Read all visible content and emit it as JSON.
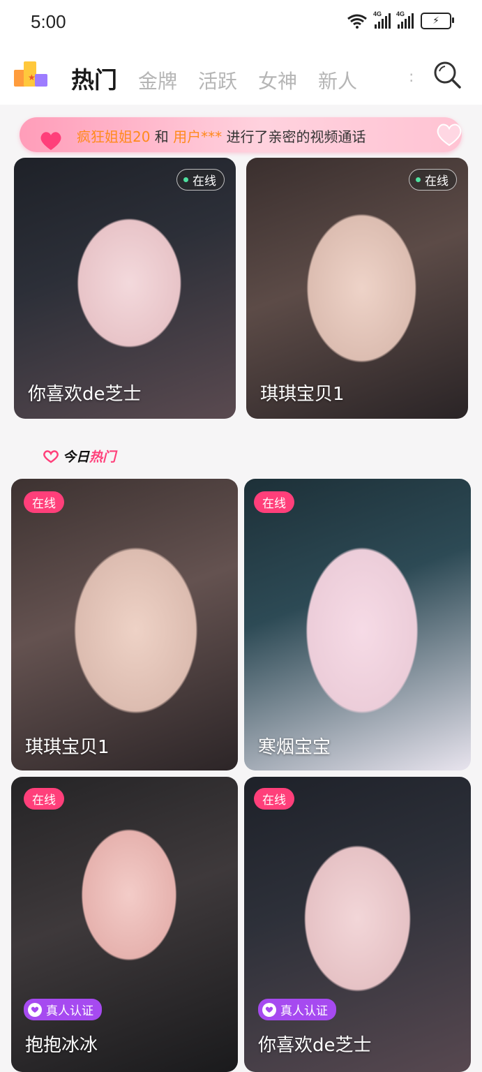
{
  "status_bar": {
    "time": "5:00",
    "signal1": "4G",
    "signal2": "4G"
  },
  "nav": {
    "tabs": [
      {
        "label": "热门",
        "active": true
      },
      {
        "label": "金牌",
        "active": false
      },
      {
        "label": "活跃",
        "active": false
      },
      {
        "label": "女神",
        "active": false
      },
      {
        "label": "新人",
        "active": false
      }
    ],
    "more": ":"
  },
  "banner": {
    "user1": "疯狂姐姐20",
    "and": " 和 ",
    "user2": "用户***",
    "action": " 进行了亲密的视频通话"
  },
  "section": {
    "title_a": "今日",
    "title_b": "热门"
  },
  "featured": [
    {
      "name": "你喜欢de芝士",
      "status": "在线"
    },
    {
      "name": "琪琪宝贝1",
      "status": "在线"
    }
  ],
  "hot": [
    {
      "name": "琪琪宝贝1",
      "status": "在线"
    },
    {
      "name": "寒烟宝宝",
      "status": "在线"
    },
    {
      "name": "抱抱冰冰",
      "status": "在线",
      "verified": "真人认证"
    },
    {
      "name": "你喜欢de芝士",
      "status": "在线",
      "verified": "真人认证"
    }
  ],
  "colors": {
    "accent": "#ff3f7a",
    "verify": "#a64af0",
    "highlight": "#ff8a1c"
  }
}
